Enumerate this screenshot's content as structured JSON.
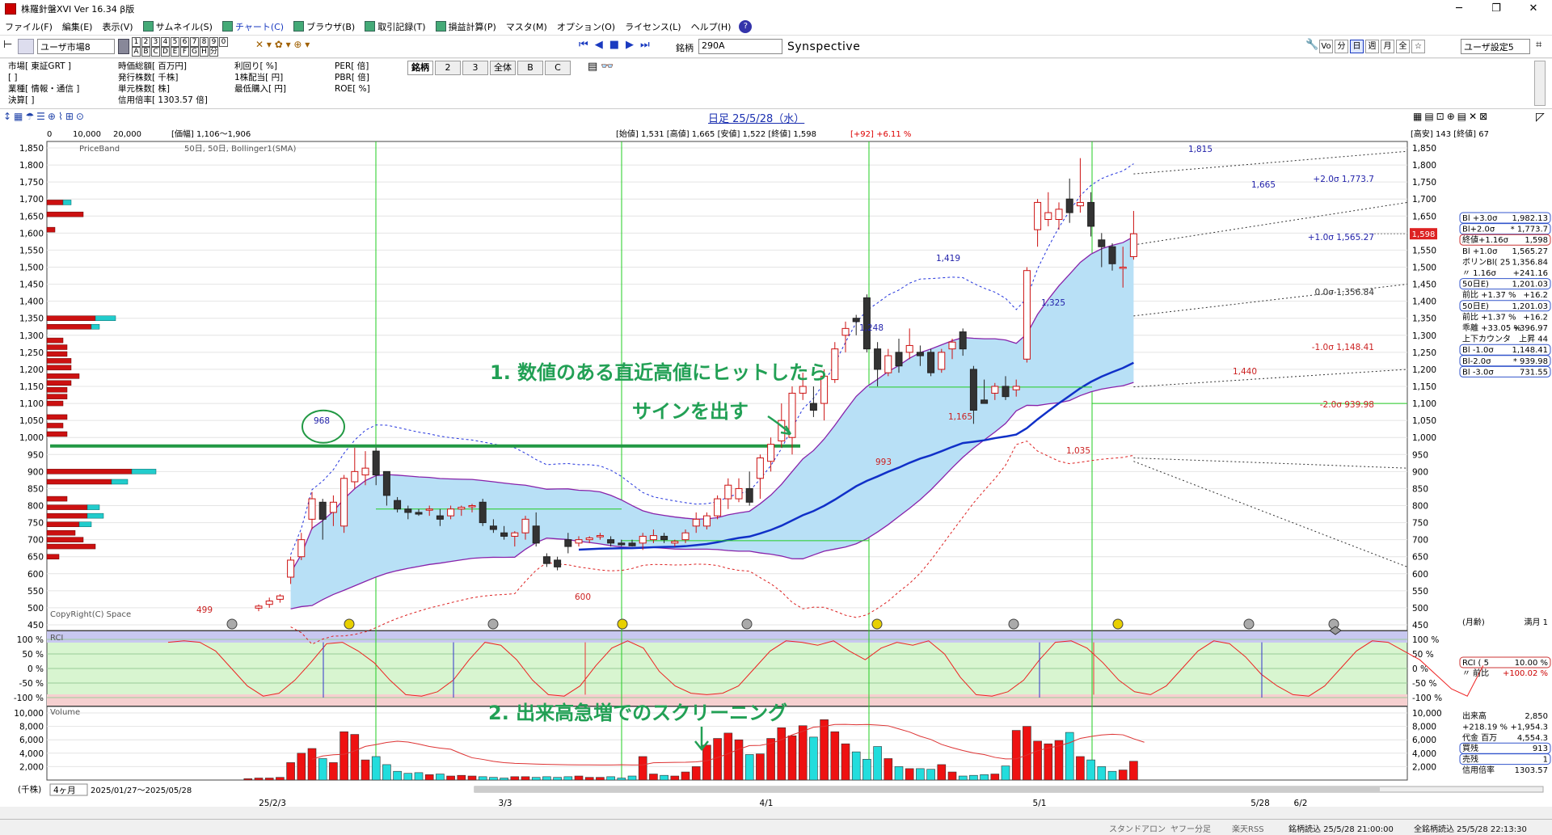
{
  "window": {
    "title": "株羅針盤XVI Ver 16.34 β版",
    "minimize": "─",
    "maximize": "❐",
    "close": "✕"
  },
  "menu": [
    {
      "label": "ファイル(F)"
    },
    {
      "label": "編集(E)"
    },
    {
      "label": "表示(V)"
    },
    {
      "label": "サムネイル(S)",
      "icon": true
    },
    {
      "label": "チャート(C)",
      "icon": true
    },
    {
      "label": "ブラウザ(B)",
      "icon": true
    },
    {
      "label": "取引記録(T)",
      "icon": true
    },
    {
      "label": "損益計算(P)",
      "icon": true
    },
    {
      "label": "マスタ(M)"
    },
    {
      "label": "オプション(O)"
    },
    {
      "label": "ライセンス(L)"
    },
    {
      "label": "ヘルプ(H)"
    }
  ],
  "toolbar": {
    "market_select": "ユーザ市場8",
    "grid_row1": [
      "1",
      "2",
      "3",
      "4",
      "5",
      "6",
      "7",
      "8",
      "9",
      "0"
    ],
    "grid_row2": [
      "A",
      "B",
      "C",
      "D",
      "E",
      "F",
      "G",
      "H",
      "分"
    ],
    "code_label": "銘柄",
    "code_value": "290A",
    "company": "Synspective",
    "period_btns": [
      "Vo",
      "分",
      "日",
      "週",
      "月",
      "全",
      "☆"
    ],
    "user_setting": "ユーザ設定5"
  },
  "info": {
    "c1": [
      "市場[ 東証GRT ]",
      "[ ]",
      "業種[ 情報・通信 ]",
      "決算[ ]"
    ],
    "c2": [
      "時価総額[ 百万円]",
      "発行株数[ 千株]",
      "単元株数[ 株]",
      "信用倍率[ 1303.57 倍]"
    ],
    "c3": [
      "利回り[ %]",
      "1株配当[ 円]",
      "最低購入[ 円]"
    ],
    "c4": [
      "PER[ 倍]",
      "PBR[ 倍]",
      "ROE[ %]"
    ],
    "tabs": [
      "銘柄",
      "2",
      "3",
      "全体",
      "B",
      "C"
    ]
  },
  "chart_header": {
    "title": "日足 25/5/28（水）",
    "ohlc": "[始値] 1,531  [高値] 1,665  [安値] 1,522  [終値] 1,598",
    "change": "[+92] +6.11 %",
    "price_range": "[価幅] 1,106～1,906",
    "vol_scale": [
      "0",
      "10,000",
      "20,000"
    ],
    "right_info": "[高安] 143  [終値] 67"
  },
  "chart_labels": {
    "priceband": "PriceBand",
    "indicator": "50日, 50日, Bollinger1(SMA)",
    "copyright": "CopyRight(C) Space",
    "rci": "RCI",
    "volume": "Volume",
    "ann1": "1. 数値のある直近高値にヒットしたら",
    "ann1b": "サインを出す",
    "ann2": "2. 出来高急増でのスクリーニング",
    "sig_labels": [
      "+2.0σ 1,773.7",
      "+1.0σ 1,565.27",
      "0.0σ 1,356.84",
      "-1.0σ 1,148.41",
      "-2.0σ 939.98"
    ],
    "peak_labels": [
      "1,815",
      "1,665",
      "1,419",
      "1,325",
      "1,248",
      "968",
      "1,440",
      "1,165",
      "1,035",
      "993",
      "600",
      "499"
    ],
    "price_tag": "1,598"
  },
  "chart_data": {
    "type": "candlestick",
    "title": "日足 25/5/28（水）",
    "y_price_range": [
      450,
      1850
    ],
    "y_price_ticks": [
      450,
      500,
      550,
      600,
      650,
      700,
      750,
      800,
      850,
      900,
      950,
      1000,
      1050,
      1100,
      1150,
      1200,
      1250,
      1300,
      1350,
      1400,
      1450,
      1500,
      1550,
      1600,
      1650,
      1700,
      1750,
      1800,
      1850
    ],
    "rci_ticks": [
      "100 %",
      "50 %",
      "0 %",
      "-50 %",
      "-100 %"
    ],
    "volume_ticks": [
      2000,
      4000,
      6000,
      8000,
      10000
    ],
    "x_ticks": [
      "25/2/3",
      "3/3",
      "4/1",
      "5/1",
      "5/28",
      "6/2"
    ],
    "candles_ohlc": [
      [
        499,
        510,
        490,
        505
      ],
      [
        510,
        530,
        500,
        520
      ],
      [
        525,
        540,
        515,
        535
      ],
      [
        590,
        650,
        570,
        640
      ],
      [
        650,
        720,
        640,
        700
      ],
      [
        760,
        840,
        730,
        820
      ],
      [
        810,
        820,
        700,
        760
      ],
      [
        780,
        830,
        740,
        810
      ],
      [
        740,
        890,
        720,
        880
      ],
      [
        870,
        970,
        850,
        900
      ],
      [
        890,
        960,
        860,
        910
      ],
      [
        960,
        970,
        860,
        890
      ],
      [
        900,
        850,
        800,
        830
      ],
      [
        815,
        825,
        780,
        790
      ],
      [
        790,
        800,
        760,
        780
      ],
      [
        780,
        790,
        770,
        775
      ],
      [
        790,
        800,
        770,
        790
      ],
      [
        770,
        790,
        740,
        760
      ],
      [
        770,
        800,
        760,
        790
      ],
      [
        790,
        800,
        770,
        795
      ],
      [
        800,
        805,
        780,
        800
      ],
      [
        810,
        820,
        740,
        750
      ],
      [
        740,
        760,
        720,
        730
      ],
      [
        720,
        740,
        700,
        710
      ],
      [
        710,
        725,
        680,
        720
      ],
      [
        720,
        770,
        700,
        760
      ],
      [
        740,
        780,
        680,
        690
      ],
      [
        650,
        660,
        620,
        630
      ],
      [
        640,
        650,
        610,
        620
      ],
      [
        700,
        720,
        660,
        680
      ],
      [
        690,
        710,
        680,
        700
      ],
      [
        700,
        710,
        690,
        705
      ],
      [
        710,
        720,
        700,
        712
      ],
      [
        700,
        710,
        680,
        690
      ],
      [
        690,
        700,
        680,
        685
      ],
      [
        690,
        700,
        680,
        682
      ],
      [
        690,
        720,
        670,
        710
      ],
      [
        700,
        730,
        690,
        712
      ],
      [
        710,
        720,
        690,
        700
      ],
      [
        690,
        700,
        680,
        695
      ],
      [
        700,
        730,
        690,
        720
      ],
      [
        740,
        780,
        720,
        760
      ],
      [
        740,
        780,
        730,
        770
      ],
      [
        770,
        830,
        760,
        820
      ],
      [
        820,
        880,
        790,
        860
      ],
      [
        820,
        880,
        810,
        850
      ],
      [
        850,
        900,
        800,
        810
      ],
      [
        880,
        950,
        820,
        940
      ],
      [
        930,
        1000,
        900,
        980
      ],
      [
        990,
        1100,
        970,
        1050
      ],
      [
        1000,
        1150,
        950,
        1130
      ],
      [
        1130,
        1190,
        1110,
        1150
      ],
      [
        1100,
        1150,
        1060,
        1080
      ],
      [
        1100,
        1200,
        1050,
        1180
      ],
      [
        1170,
        1280,
        1160,
        1260
      ],
      [
        1300,
        1340,
        1250,
        1320
      ],
      [
        1350,
        1360,
        1300,
        1340
      ],
      [
        1410,
        1420,
        1250,
        1260
      ],
      [
        1260,
        1280,
        1150,
        1200
      ],
      [
        1190,
        1260,
        1180,
        1240
      ],
      [
        1250,
        1290,
        1190,
        1210
      ],
      [
        1250,
        1320,
        1230,
        1270
      ],
      [
        1250,
        1270,
        1210,
        1240
      ],
      [
        1250,
        1260,
        1180,
        1190
      ],
      [
        1200,
        1260,
        1190,
        1250
      ],
      [
        1260,
        1290,
        1230,
        1280
      ],
      [
        1310,
        1320,
        1240,
        1260
      ],
      [
        1200,
        1210,
        1040,
        1080
      ],
      [
        1110,
        1170,
        1100,
        1100
      ],
      [
        1130,
        1160,
        1110,
        1150
      ],
      [
        1150,
        1180,
        1110,
        1120
      ],
      [
        1140,
        1170,
        1120,
        1150
      ],
      [
        1230,
        1500,
        1220,
        1490
      ],
      [
        1610,
        1700,
        1560,
        1690
      ],
      [
        1640,
        1720,
        1620,
        1660
      ],
      [
        1640,
        1690,
        1610,
        1670
      ],
      [
        1700,
        1760,
        1630,
        1660
      ],
      [
        1680,
        1820,
        1660,
        1690
      ],
      [
        1690,
        1720,
        1590,
        1620
      ],
      [
        1580,
        1600,
        1500,
        1560
      ],
      [
        1560,
        1570,
        1490,
        1510
      ],
      [
        1500,
        1560,
        1440,
        1500
      ],
      [
        1531,
        1665,
        1522,
        1598
      ]
    ],
    "volume_k": [
      200,
      300,
      300,
      400,
      2600,
      4000,
      4700,
      3200,
      2600,
      7200,
      6800,
      3000,
      3500,
      2300,
      1300,
      1000,
      1100,
      800,
      900,
      600,
      700,
      600,
      500,
      400,
      300,
      500,
      500,
      400,
      500,
      400,
      500,
      600,
      400,
      400,
      500,
      300,
      600,
      3500,
      900,
      700,
      600,
      1200,
      2000,
      5200,
      6200,
      7000,
      6000,
      3800,
      3900,
      6200,
      7800,
      6600,
      8100,
      6400,
      9000,
      7200,
      5400,
      4200,
      3100,
      5000,
      3200,
      2000,
      1700,
      1700,
      1600,
      2300,
      1200,
      600,
      700,
      800,
      900,
      2100,
      7400,
      8000,
      5800,
      5400,
      5900,
      7100,
      3500,
      3000,
      2000,
      1300,
      1500,
      2800
    ]
  },
  "rightpanel": [
    [
      "Bl +3.0σ",
      "1,982.13"
    ],
    [
      "Bl+2.0σ",
      "* 1,773.7"
    ],
    [
      "終値+1.16σ",
      "1,598"
    ],
    [
      "Bl +1.0σ",
      "1,565.27"
    ],
    [
      "ボリンBl( 25",
      "1,356.84"
    ],
    [
      "〃 1.16σ",
      "+241.16"
    ],
    [
      "50日E)",
      "1,201.03"
    ],
    [
      "前比 +1.37 %",
      "+16.2"
    ],
    [
      "50日E)",
      "1,201.03"
    ],
    [
      "前比 +1.37 %",
      "+16.2"
    ],
    [
      "乖離 +33.05 %",
      "+396.97"
    ],
    [
      "上下カウンタ",
      "上昇 44"
    ],
    [
      "Bl -1.0σ",
      "1,148.41"
    ],
    [
      "Bl-2.0σ",
      "* 939.98"
    ],
    [
      "Bl -3.0σ",
      "731.55"
    ]
  ],
  "rightpanel2": [
    [
      "(月齢)",
      "満月 1"
    ],
    [
      "RCI ( 5",
      "10.00 %"
    ],
    [
      "〃 前比",
      "+100.02 %"
    ]
  ],
  "rightpanel3": [
    [
      "出来高",
      "2,850"
    ],
    [
      "+218.19 %",
      "+1,954.3"
    ],
    [
      "代金 百万",
      "4,554.3"
    ],
    [
      "買残",
      "913"
    ],
    [
      "売残",
      "1"
    ],
    [
      "信用倍率",
      "1303.57"
    ]
  ],
  "bottombar": {
    "unit": "(千株)",
    "period": "4ヶ月",
    "range": "2025/01/27～2025/05/28"
  },
  "status": [
    "スタンドアロン",
    "ヤフー分足",
    "楽天RSS",
    "銘柄読込 25/5/28 21:00:00",
    "全銘柄読込 25/5/28 22:13:30"
  ]
}
